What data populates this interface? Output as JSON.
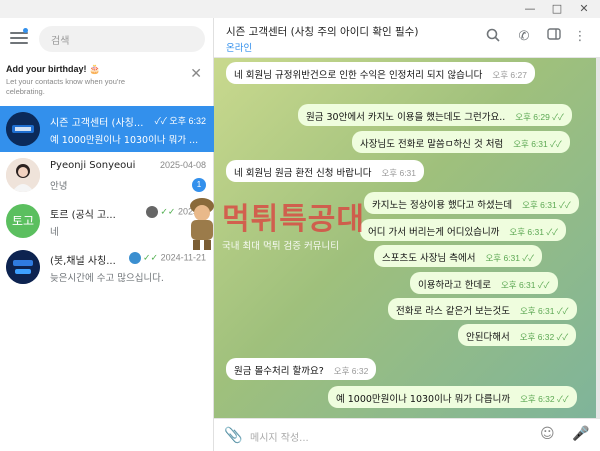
{
  "window": {
    "minimize_icon": "minimize-icon",
    "maximize_icon": "maximize-icon",
    "close_icon": "close-icon"
  },
  "sidebar": {
    "search_placeholder": "검색",
    "birthday": {
      "title": "Add your birthday! 🎂",
      "subtitle": "Let your contacts know when you're celebrating."
    },
    "chats": [
      {
        "name": "시즌 고객센터 (사칭...",
        "time": "오후 6:32",
        "preview": "예 1000만원이나 1030이나 뭐가 ...",
        "active": true
      },
      {
        "name": "Pyeonji Sonyeoui",
        "time": "2025-04-08",
        "preview": "안녕",
        "unread": "1"
      },
      {
        "name": "토르 (공식 고...",
        "time": "2025-0",
        "preview": "네",
        "avatar_text": "토고"
      },
      {
        "name": "(봇,채널 사칭...",
        "time": "2024-11-21",
        "preview": "늦은시간에 수고 많으십니다."
      }
    ]
  },
  "header": {
    "title": "시즌 고객센터 (사칭 주의 아이디 확인 필수)",
    "status": "온라인"
  },
  "messages": [
    {
      "text": "네 회원님 규정위반건으로 인한 수익은 인정처리 되지 않습니다",
      "time": "오후 6:27",
      "dir": "in"
    },
    {
      "text": "원금 30안에서 카지노 이용을 했는데도 그런가요..",
      "time": "오후 6:29",
      "dir": "out"
    },
    {
      "text": "사장님도 전화로 말씀ㅁ하신 것 처럼",
      "time": "오후 6:31",
      "dir": "out"
    },
    {
      "text": "네 회원님 원금 환전 신청 바랍니다",
      "time": "오후 6:31",
      "dir": "in"
    },
    {
      "text": "카지노는 정상이용 했다고 하셨는데",
      "time": "오후 6:31",
      "dir": "out"
    },
    {
      "text": "어디 가서 버리는게 어디있습니까",
      "time": "오후 6:31",
      "dir": "out"
    },
    {
      "text": "스포츠도 사장님 측에서",
      "time": "오후 6:31",
      "dir": "out"
    },
    {
      "text": "이용하라고 한데로",
      "time": "오후 6:31",
      "dir": "out"
    },
    {
      "text": "전화로 라스 같은거 보는것도",
      "time": "오후 6:31",
      "dir": "out"
    },
    {
      "text": "안된다해서",
      "time": "오후 6:32",
      "dir": "out"
    },
    {
      "text": "원금 몰수처리 할까요?",
      "time": "오후 6:32",
      "dir": "in"
    },
    {
      "text": "예 1000만원이나 1030이나 뭐가 다릅니까",
      "time": "오후 6:32",
      "dir": "out"
    }
  ],
  "input": {
    "placeholder": "메시지 작성..."
  },
  "watermark": {
    "title": "먹튀특공대",
    "subtitle": "국내 최대 먹튀 검증 커뮤니티"
  },
  "colors": {
    "accent": "#3390ec",
    "outgoing_bubble": "#effdde",
    "check_green": "#4fae4e"
  }
}
